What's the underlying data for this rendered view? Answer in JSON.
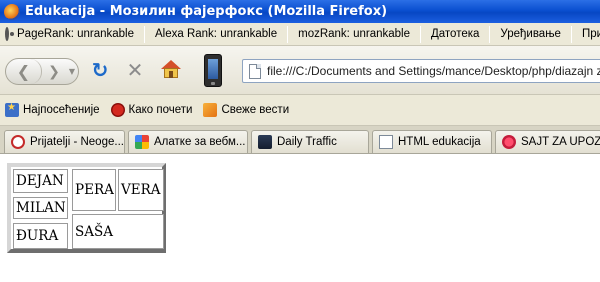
{
  "window": {
    "title": "Edukacija - Мозилин фајерфокс (Mozilla Firefox)"
  },
  "menubar": {
    "pagerank": "PageRank: unrankable",
    "alexa": "Alexa Rank: unrankable",
    "mozrank": "mozRank: unrankable",
    "menus": [
      "Датотека",
      "Уређивање",
      "Приказ"
    ]
  },
  "navbar": {
    "url": "file:///C:/Documents and Settings/mance/Desktop/php/diazajn za not"
  },
  "bookmarks": [
    {
      "icon": "star-icon",
      "label": "Најпосећеније"
    },
    {
      "icon": "firefox-icon",
      "label": "Како почети"
    },
    {
      "icon": "rss-icon",
      "label": "Свеже вести"
    }
  ],
  "tabs": [
    {
      "icon": "red-circle-icon",
      "label": "Prijatelji - Neoge..."
    },
    {
      "icon": "google-icon",
      "label": "Алатке за вебм..."
    },
    {
      "icon": "traffic-icon",
      "label": "Daily Traffic"
    },
    {
      "icon": "page-icon",
      "label": "HTML edukacija"
    },
    {
      "icon": "heart-icon",
      "label": "SAJT ZA UPOZN..."
    }
  ],
  "page_table": {
    "dejan": "DEJAN",
    "pera": "PERA",
    "vera": "VERA",
    "milan": "MILAN",
    "sasa": "SAŠA",
    "djura": "ĐURA"
  }
}
